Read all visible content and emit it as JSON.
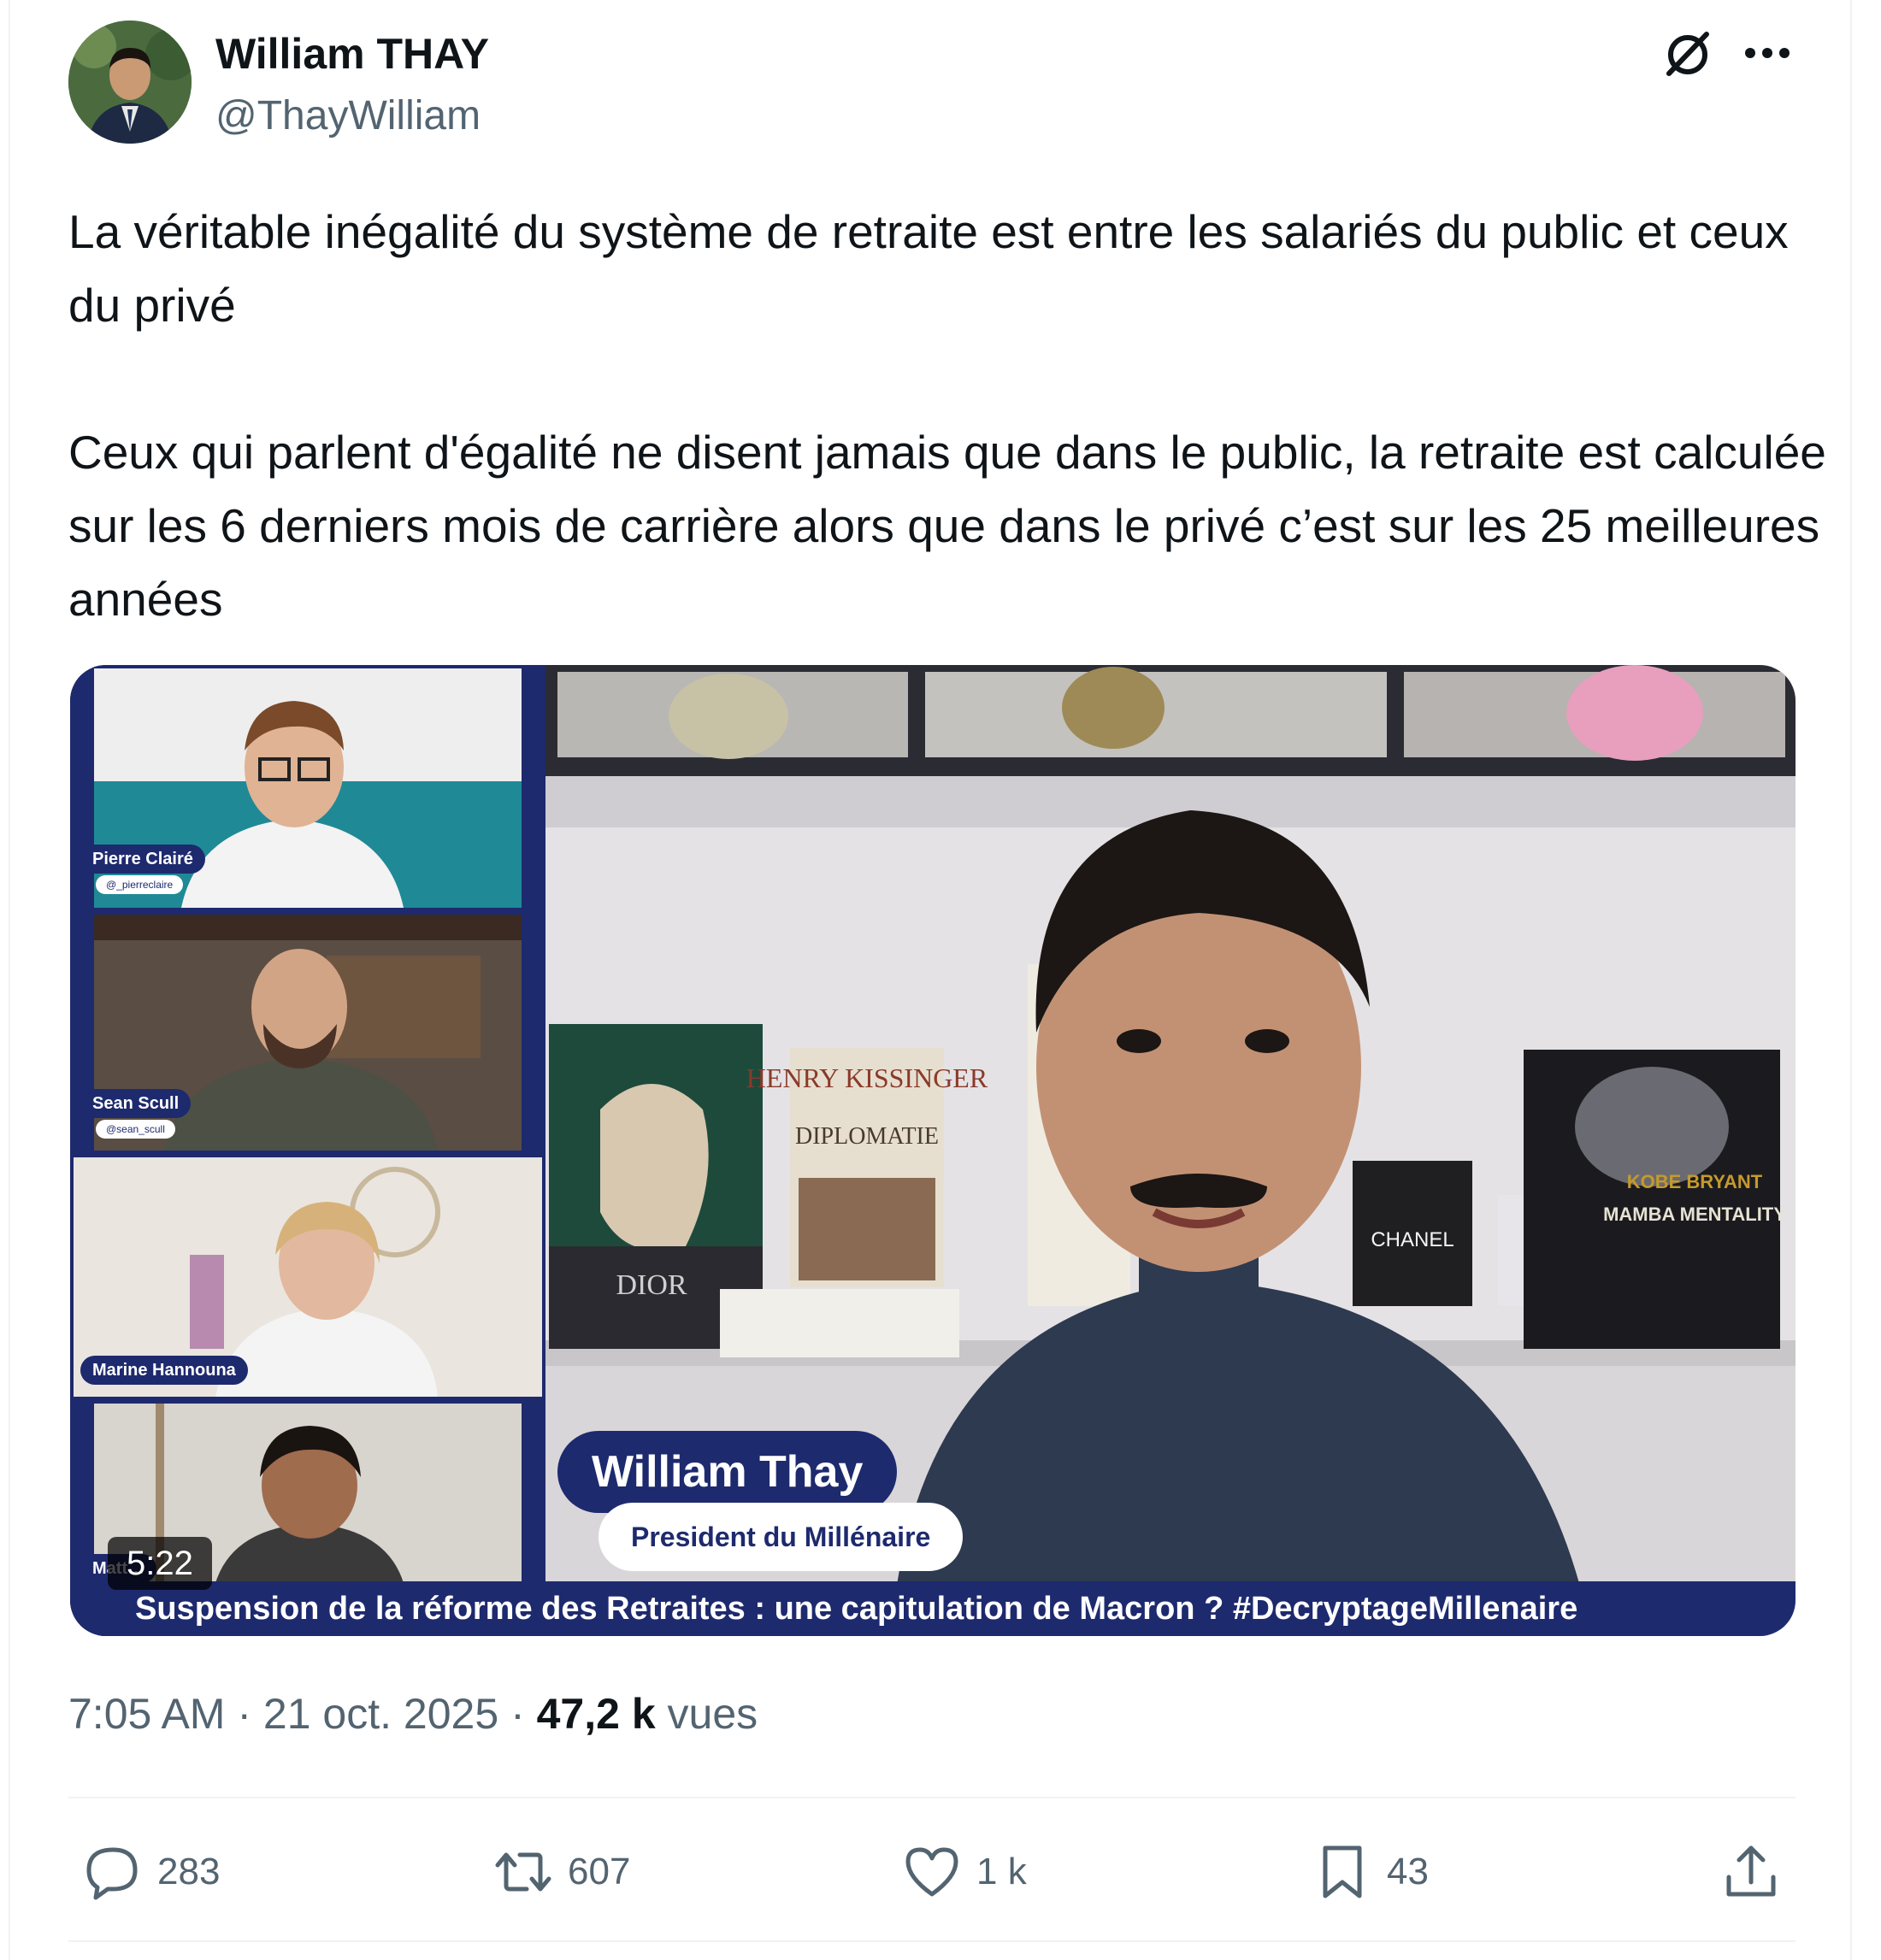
{
  "author": {
    "name": "William THAY",
    "handle": "@ThayWilliam"
  },
  "header_icons": [
    "grok-icon",
    "more-icon"
  ],
  "tweet": {
    "paragraphs": [
      "La véritable inégalité du système de retraite est entre les salariés du public et ceux du privé",
      "Ceux qui parlent d'égalité ne disent jamais que dans le public, la retraite est calculée sur les 6 derniers mois de carrière alors que dans le privé c’est sur les 25 meilleures années"
    ]
  },
  "video": {
    "speaker_name": "William Thay",
    "speaker_title": "President du Millénaire",
    "participants": [
      {
        "name": "Pierre Clairé",
        "handle": "@_pierreclaire"
      },
      {
        "name": "Sean Scull",
        "handle": "@sean_scull"
      },
      {
        "name": "Marine Hannouna",
        "handle": ""
      },
      {
        "name": "Matt…",
        "handle": ""
      }
    ],
    "ticker": "Suspension de la réforme des Retraites : une capitulation de Macron ? #DecryptageMillenaire",
    "duration": "5:22",
    "books": [
      "HENRY KISSINGER",
      "DIPLOMATIE",
      "DIOR",
      "CHANEL",
      "KOBE BRYANT",
      "MAMBA MENTALITY"
    ]
  },
  "meta": {
    "time": "7:05 AM",
    "separator": "·",
    "date": "21 oct. 2025",
    "views_count": "47,2 k",
    "views_label": "vues"
  },
  "actions": {
    "replies": "283",
    "reposts": "607",
    "likes": "1 k",
    "bookmarks": "43"
  },
  "colors": {
    "text": "#0f1419",
    "secondary": "#536471",
    "border": "#eff3f4",
    "overlay_navy": "#1e2a6e"
  }
}
